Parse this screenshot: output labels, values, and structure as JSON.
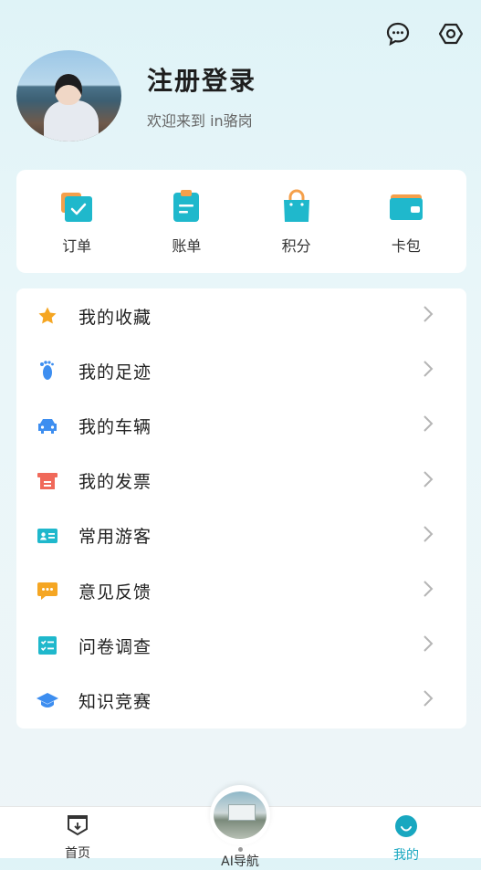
{
  "profile": {
    "name": "注册登录",
    "welcome": "欢迎来到 in骆岗"
  },
  "top_icons": [
    "message-icon",
    "settings-icon"
  ],
  "quick_actions": [
    {
      "label": "订单",
      "icon": "order-icon"
    },
    {
      "label": "账单",
      "icon": "bill-icon"
    },
    {
      "label": "积分",
      "icon": "points-bag-icon"
    },
    {
      "label": "卡包",
      "icon": "wallet-icon"
    }
  ],
  "menu": [
    {
      "label": "我的收藏",
      "icon": "star-icon"
    },
    {
      "label": "我的足迹",
      "icon": "footprint-icon"
    },
    {
      "label": "我的车辆",
      "icon": "car-icon"
    },
    {
      "label": "我的发票",
      "icon": "invoice-icon"
    },
    {
      "label": "常用游客",
      "icon": "id-card-icon"
    },
    {
      "label": "意见反馈",
      "icon": "feedback-icon"
    },
    {
      "label": "问卷调查",
      "icon": "survey-icon"
    },
    {
      "label": "知识竞赛",
      "icon": "graduation-cap-icon"
    }
  ],
  "tabbar": {
    "home": "首页",
    "ai": "AI导航",
    "me": "我的"
  },
  "colors": {
    "accent": "#18a7c0",
    "quick_icon": "#1fb8cc",
    "order_accent": "#f5a04b",
    "star": "#f5a623",
    "blue": "#3d8ef0",
    "red": "#f0695a"
  }
}
